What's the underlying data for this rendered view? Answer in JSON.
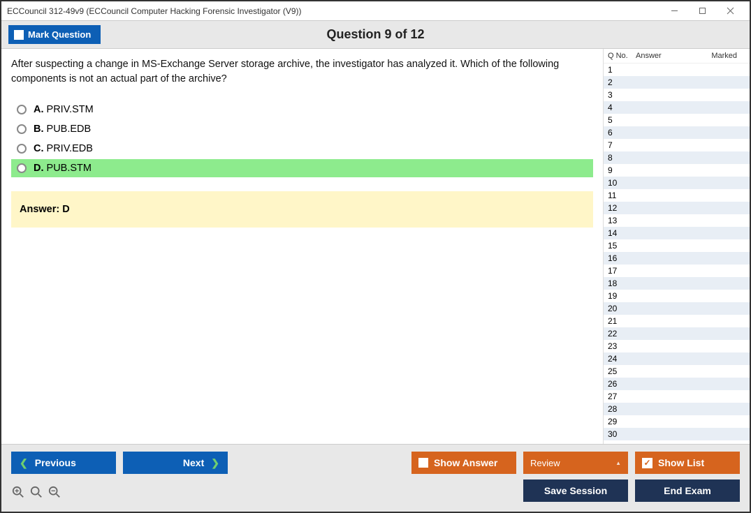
{
  "window": {
    "title": "ECCouncil 312-49v9 (ECCouncil Computer Hacking Forensic Investigator (V9))"
  },
  "header": {
    "mark_label": "Mark Question",
    "counter": "Question 9 of 12"
  },
  "question": {
    "text": "After suspecting a change in MS-Exchange Server storage archive, the investigator has analyzed it. Which of the following components is not an actual part of the archive?",
    "options": [
      {
        "letter": "A.",
        "text": "PRIV.STM",
        "correct": false
      },
      {
        "letter": "B.",
        "text": "PUB.EDB",
        "correct": false
      },
      {
        "letter": "C.",
        "text": "PRIV.EDB",
        "correct": false
      },
      {
        "letter": "D.",
        "text": "PUB.STM",
        "correct": true
      }
    ],
    "answer_label": "Answer: D"
  },
  "side": {
    "headers": {
      "qno": "Q No.",
      "answer": "Answer",
      "marked": "Marked"
    },
    "rows": [
      1,
      2,
      3,
      4,
      5,
      6,
      7,
      8,
      9,
      10,
      11,
      12,
      13,
      14,
      15,
      16,
      17,
      18,
      19,
      20,
      21,
      22,
      23,
      24,
      25,
      26,
      27,
      28,
      29,
      30
    ]
  },
  "buttons": {
    "previous": "Previous",
    "next": "Next",
    "show_answer": "Show Answer",
    "review": "Review",
    "show_list": "Show List",
    "save_session": "Save Session",
    "end_exam": "End Exam"
  }
}
